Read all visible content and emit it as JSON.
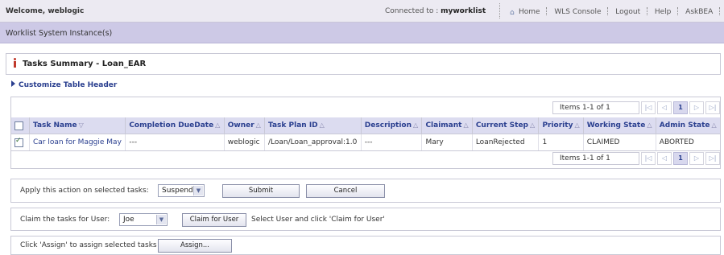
{
  "topbar": {
    "welcome": "Welcome, weblogic",
    "connected_prefix": "Connected to : ",
    "connected_name": "myworklist",
    "links": [
      "Home",
      "WLS Console",
      "Logout",
      "Help",
      "AskBEA"
    ]
  },
  "instance_bar": {
    "title": "Worklist System Instance(s)"
  },
  "summary": {
    "title": "Tasks Summary - Loan_EAR"
  },
  "customize_link": "Customize Table Header",
  "pager": {
    "items_text": "Items 1-1 of 1",
    "first": "|◁",
    "prev": "◁",
    "page": "1",
    "next": "▷",
    "last": "▷|"
  },
  "table": {
    "headers": [
      "Task Name",
      "Completion DueDate",
      "Owner",
      "Task Plan ID",
      "Description",
      "Claimant",
      "Current Step",
      "Priority",
      "Working State",
      "Admin State"
    ],
    "rows": [
      {
        "checked": true,
        "cells": [
          "Car loan for Maggie May",
          "---",
          "weblogic",
          "/Loan/Loan_approval:1.0",
          "---",
          "Mary",
          "LoanRejected",
          "1",
          "CLAIMED",
          "ABORTED"
        ]
      }
    ]
  },
  "action_panel": {
    "label": "Apply this action on selected tasks:",
    "selected_action": "Suspend",
    "submit_label": "Submit",
    "cancel_label": "Cancel"
  },
  "claim_panel": {
    "label": "Claim the tasks for User:",
    "selected_user": "Joe",
    "button_label": "Claim for User",
    "hint": "Select User and click 'Claim for User'"
  },
  "assign_panel": {
    "label": "Click 'Assign' to assign selected tasks",
    "button_label": "Assign..."
  }
}
